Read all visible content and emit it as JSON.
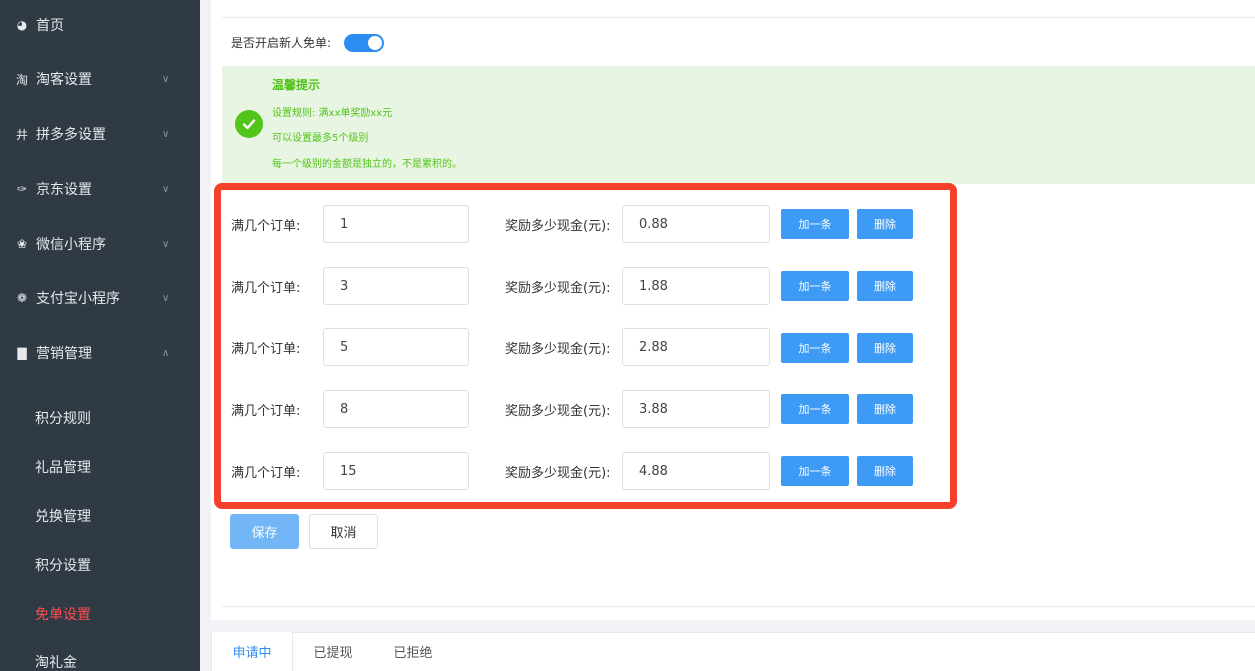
{
  "sidebar": {
    "menu": [
      {
        "label": "首页",
        "icon": "dashboard-icon",
        "glyph": "◕",
        "chevron": ""
      },
      {
        "label": "淘客设置",
        "icon": "taobao-icon",
        "glyph": "淘",
        "chevron": "∨"
      },
      {
        "label": "拼多多设置",
        "icon": "pinduoduo-icon",
        "glyph": "井",
        "chevron": "∨"
      },
      {
        "label": "京东设置",
        "icon": "jd-icon",
        "glyph": "✑",
        "chevron": "∨"
      },
      {
        "label": "微信小程序",
        "icon": "wechat-miniprogram-icon",
        "glyph": "❀",
        "chevron": "∨"
      },
      {
        "label": "支付宝小程序",
        "icon": "alipay-icon",
        "glyph": "❁",
        "chevron": "∨"
      },
      {
        "label": "营销管理",
        "icon": "marketing-chart-icon",
        "glyph": "▇",
        "chevron": "∧"
      }
    ],
    "submenu": [
      {
        "label": "积分规则",
        "active": false
      },
      {
        "label": "礼品管理",
        "active": false
      },
      {
        "label": "兑换管理",
        "active": false
      },
      {
        "label": "积分设置",
        "active": false
      },
      {
        "label": "免单设置",
        "active": true
      },
      {
        "label": "淘礼金",
        "active": false
      }
    ]
  },
  "form": {
    "toggle_label": "是否开启新人免单:",
    "toggle_on": true
  },
  "tips": {
    "title": "温馨提示",
    "lines": [
      "设置规则: 满xx单奖励xx元",
      "可以设置最多5个级别",
      "每一个级别的金额是独立的，不是累积的。"
    ]
  },
  "rules": {
    "orders_label": "满几个订单:",
    "cash_label": "奖励多少现金(元):",
    "add_label": "加一条",
    "delete_label": "删除",
    "rows": [
      {
        "orders": "1",
        "cash": "0.88"
      },
      {
        "orders": "3",
        "cash": "1.88"
      },
      {
        "orders": "5",
        "cash": "2.88"
      },
      {
        "orders": "8",
        "cash": "3.88"
      },
      {
        "orders": "15",
        "cash": "4.88"
      }
    ]
  },
  "actions": {
    "save": "保存",
    "cancel": "取消"
  },
  "tabs": [
    {
      "label": "申请中",
      "active": true
    },
    {
      "label": "已提现",
      "active": false
    },
    {
      "label": "已拒绝",
      "active": false
    }
  ],
  "colors": {
    "accent": "#2d8cf0",
    "active_menu": "#ff4d4f",
    "tip_green": "#52c41a",
    "highlight": "#f5402c"
  }
}
